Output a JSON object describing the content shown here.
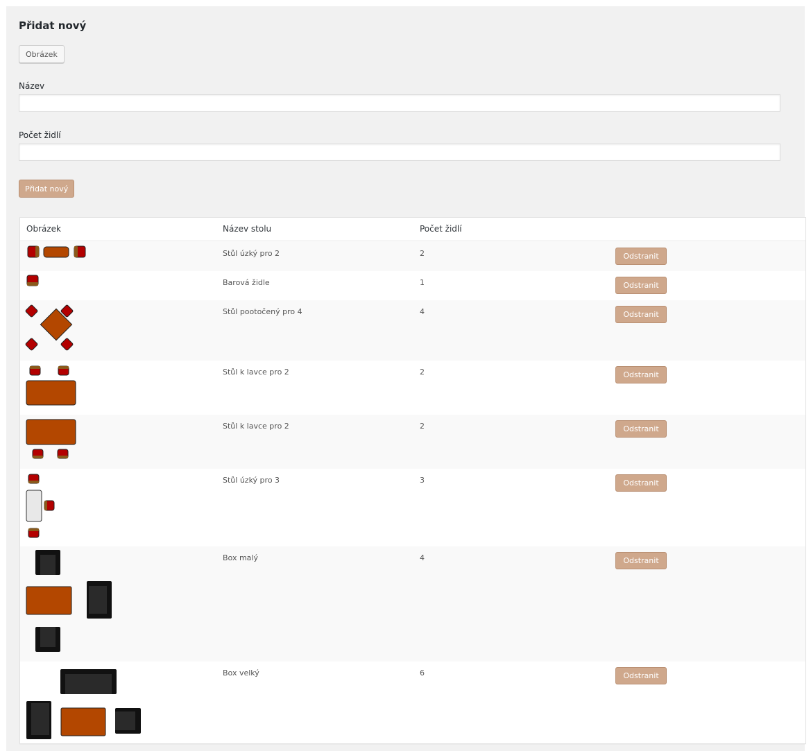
{
  "form": {
    "title": "Přidat nový",
    "image_button_label": "Obrázek",
    "name_label": "Název",
    "name_value": "",
    "chairs_label": "Počet židlí",
    "chairs_value": "",
    "submit_label": "Přidat nový"
  },
  "table": {
    "headers": [
      "Obrázek",
      "Název stolu",
      "Počet židlí"
    ],
    "delete_label": "Odstranit",
    "rows": [
      {
        "icon": "narrow-table-2-chairs-icon",
        "name": "Stůl úzký pro 2",
        "chairs": "2"
      },
      {
        "icon": "bar-stool-icon",
        "name": "Barová židle",
        "chairs": "1"
      },
      {
        "icon": "rotated-table-4-chairs-icon",
        "name": "Stůl pootočený pro 4",
        "chairs": "4"
      },
      {
        "icon": "bench-table-chairs-top-icon",
        "name": "Stůl k lavce pro 2",
        "chairs": "2"
      },
      {
        "icon": "bench-table-chairs-bottom-icon",
        "name": "Stůl k lavce pro 2",
        "chairs": "2"
      },
      {
        "icon": "narrow-table-3-chairs-icon",
        "name": "Stůl úzký pro 3",
        "chairs": "3"
      },
      {
        "icon": "small-booth-icon",
        "name": "Box malý",
        "chairs": "4"
      },
      {
        "icon": "large-booth-icon",
        "name": "Box velký",
        "chairs": "6"
      }
    ]
  },
  "colors": {
    "table_wood": "#b34700",
    "chair_red": "#b30000",
    "booth_black": "#1f1f1f",
    "button_accent": "#cfa88c"
  }
}
